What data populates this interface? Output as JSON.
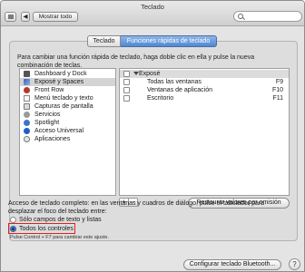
{
  "window": {
    "title": "Teclado"
  },
  "toolbar": {
    "grid_icon": "grid-icon",
    "back_label": "◀",
    "show_all_label": "Mostrar todo",
    "search_value": "",
    "search_icon": "magnifier-icon"
  },
  "tabs": [
    {
      "label": "Teclado",
      "active": false
    },
    {
      "label": "Funciones rápidas de teclado",
      "active": true
    }
  ],
  "description": "Para cambiar una función rápida de teclado, haga doble clic en ella y pulse la nueva combinación de teclas.",
  "categories": [
    {
      "label": "Dashboard y Dock",
      "icon": "dashboard-icon",
      "selected": false
    },
    {
      "label": "Exposé y Spaces",
      "icon": "expose-icon",
      "selected": true
    },
    {
      "label": "Front Row",
      "icon": "front-row-icon",
      "selected": false
    },
    {
      "label": "Menú teclado y texto",
      "icon": "menu-icon",
      "selected": false
    },
    {
      "label": "Capturas de pantalla",
      "icon": "camera-icon",
      "selected": false
    },
    {
      "label": "Servicios",
      "icon": "gear-icon",
      "selected": false
    },
    {
      "label": "Spotlight",
      "icon": "spotlight-icon",
      "selected": false
    },
    {
      "label": "Acceso Universal",
      "icon": "accessibility-icon",
      "selected": false
    },
    {
      "label": "Aplicaciones",
      "icon": "applications-icon",
      "selected": false
    }
  ],
  "shortcuts": {
    "group_label": "Exposé",
    "items": [
      {
        "label": "Todas las ventanas",
        "key": "F9",
        "checked": false
      },
      {
        "label": "Ventanas de aplicación",
        "key": "F10",
        "checked": false
      },
      {
        "label": "Escritorio",
        "key": "F11",
        "checked": false
      }
    ]
  },
  "buttons": {
    "add": "+",
    "remove": "–",
    "restore_defaults": "Restaurar valores por omisión",
    "bluetooth_setup": "Configurar teclado Bluetooth...",
    "help": "?"
  },
  "full_keyboard_access": {
    "description": "Acceso de teclado completo: en las ventanas y cuadros de diálogo, pulse el tabulador para desplazar el foco del teclado entre:",
    "options": [
      {
        "label": "Sólo campos de texto y listas",
        "selected": false
      },
      {
        "label": "Todos los controles",
        "selected": true
      }
    ],
    "hint": "Pulse Control + F7 para cambiar este ajuste."
  },
  "colors": {
    "accent": "#4f88d3",
    "highlight": "#e02020",
    "selection": "#d4d4d4"
  }
}
